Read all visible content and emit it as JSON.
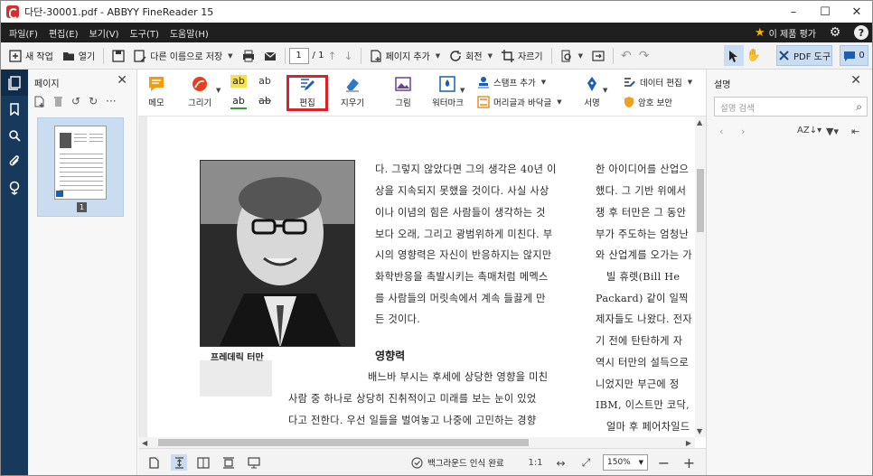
{
  "window": {
    "title": "다단-30001.pdf - ABBYY FineReader 15",
    "controls": {
      "minimize": "–",
      "maximize": "☐",
      "close": "✕"
    }
  },
  "menu": {
    "items": [
      "파일(F)",
      "편집(E)",
      "보기(V)",
      "도구(T)",
      "도움말(H)"
    ],
    "rate_label": "이 제품 평가"
  },
  "toolbar": {
    "new_task": "새 작업",
    "open": "열기",
    "save_as": "다른 이름으로 저장",
    "page_current": "1",
    "page_total": "/ 1",
    "add_page": "페이지 추가",
    "rotate": "회전",
    "crop": "자르기",
    "pdf_tools": "PDF 도구",
    "comments_count": "0"
  },
  "left_rail": {
    "icons": [
      "pages-icon",
      "bookmark-icon",
      "search-icon",
      "attachment-icon",
      "signature-icon"
    ]
  },
  "pages_panel": {
    "title": "페이지",
    "thumbnail_label": "1"
  },
  "edit_toolbar": {
    "memo": "메모",
    "draw": "그리기",
    "edit": "편집",
    "erase": "지우기",
    "picture": "그림",
    "watermark": "워터마크",
    "stamp_add": "스탬프 추가",
    "header_footer": "머리글과 바닥글",
    "signature": "서명",
    "data_edit": "데이터 편집",
    "password_security": "암호 보안",
    "ab_text": "ab"
  },
  "document": {
    "photo_caption": "프레데릭 터만",
    "col1_lines": [
      "다. 그렇지 않았다면 그의 생각은 40년 이",
      "상을 지속되지 못했을 것이다. 사실 사상",
      "이나 이념의 힘은 사람들이 생각하는 것",
      "보다 오래, 그리고 광범위하게 미친다. 부",
      "시의 영향력은 자신이 반응하지는 않지만",
      "화학반응을 촉발시키는 촉매처럼 메멕스",
      "를 사람들의 머릿속에서 계속 들끓게 만",
      "든 것이다."
    ],
    "heading": "영향력",
    "col1_after_heading": [
      "배느바 부시는 후세에 상당한 영향을 미친",
      "사람 중 하나로 상당히 진취적이고 미래를 보는 눈이 있었",
      "다고 전한다. 우선 일들을 벌여놓고 나중에 고민하는 경향"
    ],
    "col2_lines": [
      "한 아이디어를 산업으",
      "했다. 그 기반 위에서",
      "쟁 후 터만은 그 동안",
      "부가 주도하는 엄청난",
      "와 산업계를 오가는 가",
      "빌 휴렛(Bill He",
      "Packard) 같이 일찍",
      "제자들도 나왔다. 전자",
      "기 전에 탄탄하게 자",
      "역시 터만의 설득으로",
      "니었지만 부근에 정",
      "IBM, 이스트만 코닥,",
      "얼마 후 페어차일드"
    ]
  },
  "status": {
    "bg_recognition": "백그라운드 인식 완료",
    "ratio": "1:1",
    "zoom": "150%"
  },
  "right_panel": {
    "title": "설명",
    "search_placeholder": "설명 검색"
  },
  "colors": {
    "menubar_bg": "#1f1f1f",
    "rail_bg": "#17395b",
    "highlight_red": "#d9232a",
    "selected_blue": "#c9dcf0"
  }
}
